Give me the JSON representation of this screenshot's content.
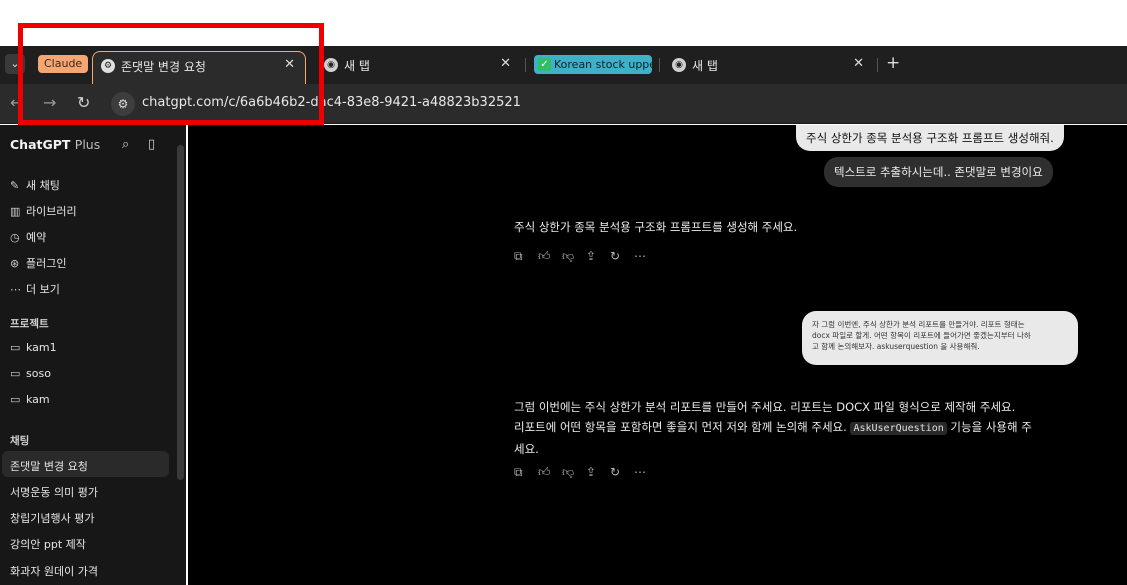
{
  "browser": {
    "tab_group_label": "Claude",
    "tabs": [
      {
        "title": "존댓말 변경 요청",
        "active": true
      },
      {
        "title": "새 탭",
        "active": false
      },
      {
        "title": "Korean stock uppe",
        "active": false
      },
      {
        "title": "새 탭",
        "active": false
      }
    ],
    "close_glyph": "✕",
    "new_tab_glyph": "+",
    "url": "chatgpt.com/c/6a6b46b2-dac4-83e8-9421-a48823b32521"
  },
  "sidebar": {
    "brand": "ChatGPT",
    "brand_suffix": "Plus",
    "nav": [
      {
        "icon": "edit-icon",
        "label": "새 채팅"
      },
      {
        "icon": "library-icon",
        "label": "라이브러리"
      },
      {
        "icon": "clock-icon",
        "label": "예약"
      },
      {
        "icon": "plugin-icon",
        "label": "플러그인"
      },
      {
        "icon": "more-icon",
        "label": "더 보기"
      }
    ],
    "projects_header": "프로젝트",
    "projects": [
      "kam1",
      "soso",
      "kam"
    ],
    "chats_header": "채팅",
    "chats": [
      "존댓말 변경 요청",
      "서명운동 의미 평가",
      "창립기념행사 평가",
      "강의안 ppt 제작",
      "화과자 원데이 가격"
    ]
  },
  "conversation": {
    "user_msg_1": "주식 상한가 종목 분석용 구조화 프롬프트 생성해줘.",
    "user_msg_2": "텍스트로 추출하시는데.. 존댓말로 변경이요",
    "assistant_msg_1": "주식 상한가 종목 분석용 구조화 프롬프트를 생성해 주세요.",
    "user_msg_3_lines": [
      "자 그럼 이번엔, 주식 상한가 분석 리포트를 만들거야. 리포트 형태는",
      "docx 파일로 할게. 어떤 항목이 리포트에 들어가면 좋겠는지부터 나하",
      "고 함께 논의해보자. askuserquestion 을 사용해줘."
    ],
    "assistant_msg_2_line1": "그럼 이번에는 주식 상한가 분석 리포트를 만들어 주세요. 리포트는 DOCX 파일 형식으로 제작해 주세요.",
    "assistant_msg_2_line2_pre": "리포트에 어떤 항목을 포함하면 좋을지 먼저 저와 함께 논의해 주세요.",
    "assistant_msg_2_code": "AskUserQuestion",
    "assistant_msg_2_line2_post": "기능을 사용해 주",
    "assistant_msg_2_line3": "세요."
  },
  "colors": {
    "highlight": "#ee0000",
    "tab_group": "#f6a673",
    "korean_chip": "#3fb0c8"
  }
}
